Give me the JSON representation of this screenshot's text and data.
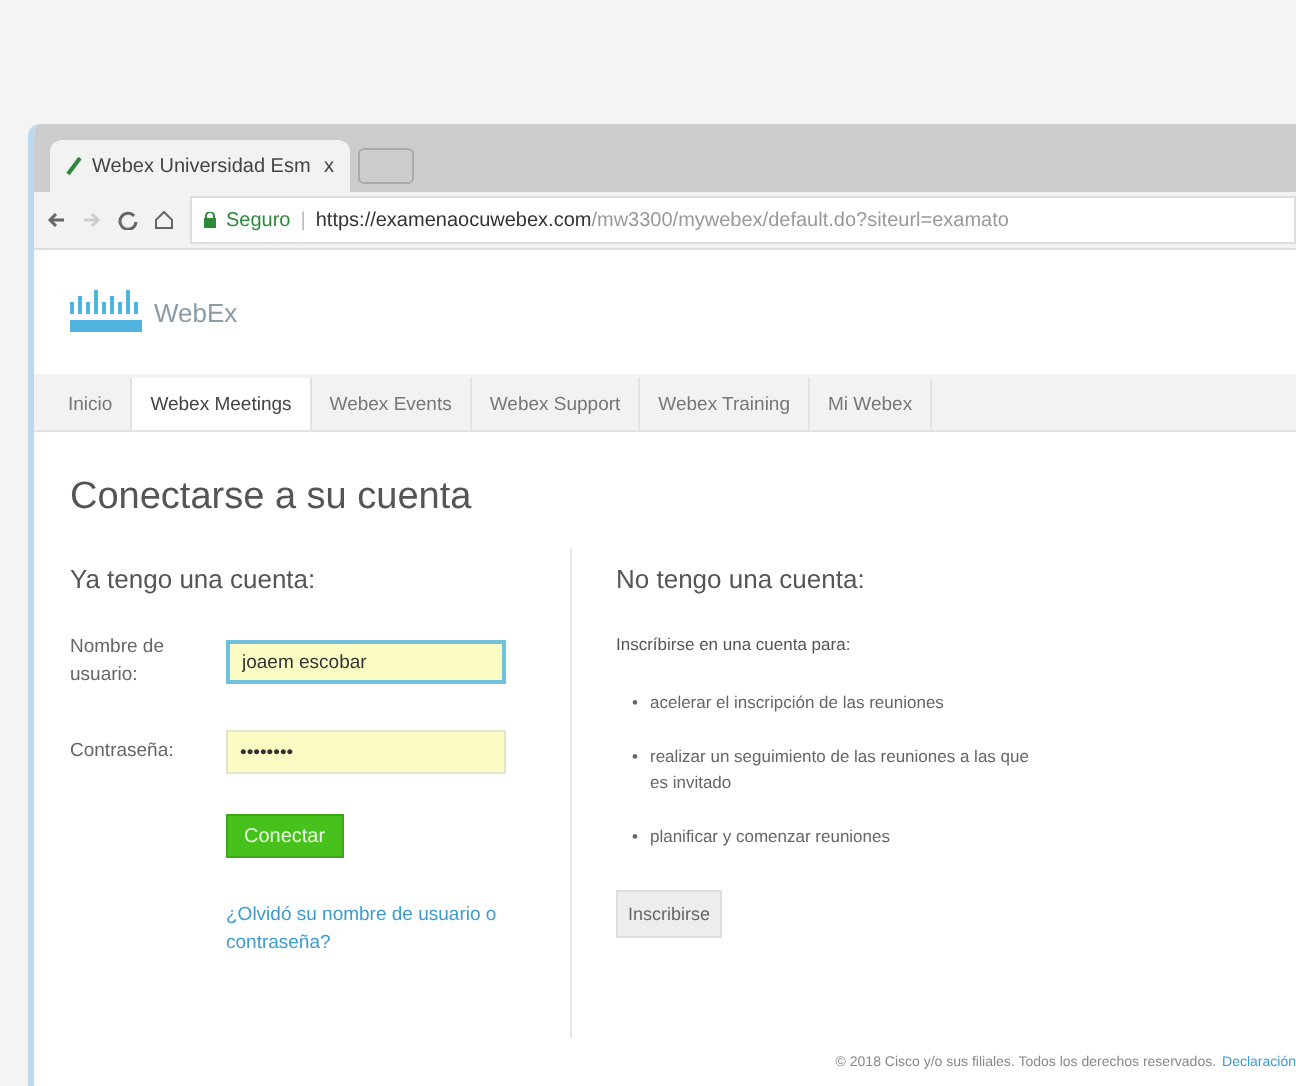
{
  "browser": {
    "tab_title": "Webex Universidad Esm",
    "tab_close": "x",
    "secure_label": "Seguro",
    "separator": "|",
    "url_host": "https://examenaocuwebex.com",
    "url_path": "/mw3300/mywebex/default.do?siteurl=examato"
  },
  "logo": {
    "product": "WebEx"
  },
  "nav": [
    {
      "label": "Inicio",
      "selected": false
    },
    {
      "label": "Webex Meetings",
      "selected": true
    },
    {
      "label": "Webex Events",
      "selected": false
    },
    {
      "label": "Webex Support",
      "selected": false
    },
    {
      "label": "Webex Training",
      "selected": false
    },
    {
      "label": "Mi Webex",
      "selected": false
    }
  ],
  "page_title": "Conectarse a su cuenta",
  "login": {
    "heading": "Ya tengo una cuenta:",
    "username_label": "Nombre de usuario:",
    "username_value": "joaem escobar",
    "password_label": "Contraseña:",
    "password_value": "••••••••",
    "submit": "Conectar",
    "forgot_link": "¿Olvidó su nombre de usuario o contraseña?"
  },
  "signup": {
    "heading": "No tengo una cuenta:",
    "intro": "Inscríbirse en una cuenta para:",
    "bullet": "•",
    "benefits": [
      "acelerar el inscripción de las reuniones",
      "realizar un seguimiento de las reuniones a las que es invitado",
      "planificar y comenzar reuniones"
    ],
    "button": "Inscribirse"
  },
  "footer": {
    "text": "© 2018 Cisco y/o sus filiales. Todos los derechos reservados.",
    "link": "Declaración"
  }
}
